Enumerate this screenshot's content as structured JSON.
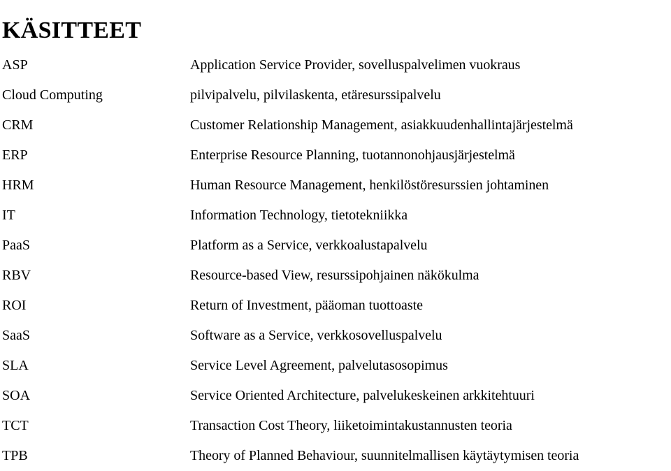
{
  "document": {
    "title": "KÄSITTEET",
    "glossary": {
      "rows": [
        {
          "term": "ASP",
          "definition": "Application Service Provider, sovelluspalvelimen vuokraus"
        },
        {
          "term": "Cloud Computing",
          "definition": "pilvipalvelu, pilvilaskenta, etäresurssipalvelu"
        },
        {
          "term": "CRM",
          "definition": "Customer Relationship Management, asiakkuudenhallintajärjestelmä"
        },
        {
          "term": "ERP",
          "definition": "Enterprise Resource Planning, tuotannonohjausjärjestelmä"
        },
        {
          "term": "HRM",
          "definition": "Human Resource Management, henkilöstöresurssien johtaminen"
        },
        {
          "term": "IT",
          "definition": "Information Technology, tietotekniikka"
        },
        {
          "term": "PaaS",
          "definition": "Platform as a Service, verkkoalustapalvelu"
        },
        {
          "term": "RBV",
          "definition": "Resource-based View, resurssipohjainen näkökulma"
        },
        {
          "term": "ROI",
          "definition": "Return of Investment, pääoman tuottoaste"
        },
        {
          "term": "SaaS",
          "definition": "Software as a Service, verkkosovelluspalvelu"
        },
        {
          "term": "SLA",
          "definition": "Service Level Agreement, palvelutasosopimus"
        },
        {
          "term": "SOA",
          "definition": "Service Oriented Architecture, palvelukeskeinen arkkitehtuuri"
        },
        {
          "term": "TCT",
          "definition": "Transaction Cost Theory, liiketoimintakustannusten teoria"
        },
        {
          "term": "TPB",
          "definition": "Theory of Planned Behaviour, suunnitelmallisen käytäytymisen teoria"
        }
      ]
    }
  }
}
